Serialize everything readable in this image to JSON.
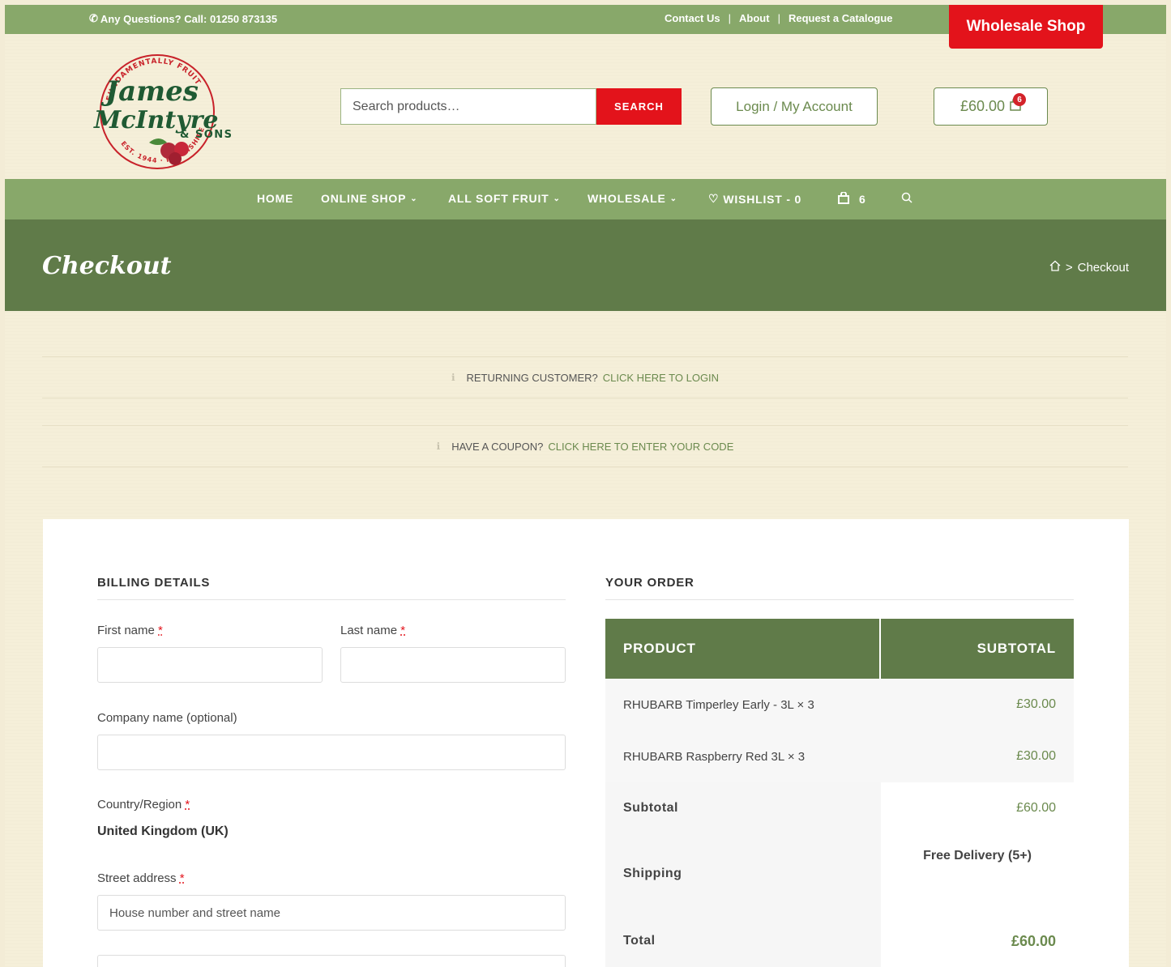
{
  "topbar": {
    "phone": "Any Questions? Call: 01250 873135",
    "links": [
      "Contact Us",
      "About",
      "Request a Catalogue"
    ],
    "wholesale": "Wholesale Shop"
  },
  "logo": {
    "line1": "James",
    "line2": "McIntyre",
    "sons": "& SONS",
    "arc_top": "FUNDAMENTALLY FRUIT",
    "arc_bottom": "EST. 1944 · PERTHSHIRE"
  },
  "header": {
    "search_placeholder": "Search products…",
    "search_button": "SEARCH",
    "login": "Login / My Account",
    "cart_total": "£60.00",
    "cart_count": "6"
  },
  "nav": {
    "home": "HOME",
    "online_shop": "ONLINE SHOP",
    "all_soft_fruit": "ALL SOFT FRUIT",
    "wholesale": "WHOLESALE",
    "wishlist": "WISHLIST - 0",
    "cart_count": "6"
  },
  "banner": {
    "title": "Checkout",
    "breadcrumb_current": "Checkout",
    "breadcrumb_sep": ">"
  },
  "notices": {
    "returning_text": "RETURNING CUSTOMER?",
    "returning_link": "CLICK HERE TO LOGIN",
    "coupon_text": "HAVE A COUPON?",
    "coupon_link": "CLICK HERE TO ENTER YOUR CODE"
  },
  "billing": {
    "heading": "BILLING DETAILS",
    "first_name": "First name",
    "last_name": "Last name",
    "company": "Company name (optional)",
    "country_label": "Country/Region",
    "country_value": "United Kingdom (UK)",
    "street_label": "Street address",
    "street_placeholder": "House number and street name",
    "required_mark": "*"
  },
  "order": {
    "heading": "YOUR ORDER",
    "col_product": "PRODUCT",
    "col_subtotal": "SUBTOTAL",
    "items": [
      {
        "name": "RHUBARB Timperley Early - 3L",
        "qty": "× 3",
        "price": "£30.00"
      },
      {
        "name": "RHUBARB Raspberry Red 3L",
        "qty": "× 3",
        "price": "£30.00"
      }
    ],
    "subtotal_label": "Subtotal",
    "subtotal_value": "£60.00",
    "shipping_label": "Shipping",
    "shipping_value": "Free Delivery (5+)",
    "total_label": "Total",
    "total_value": "£60.00"
  },
  "colors": {
    "green_light": "#88a86a",
    "green_dark": "#607b49",
    "red": "#e3131b",
    "cream": "#f5efd9"
  }
}
